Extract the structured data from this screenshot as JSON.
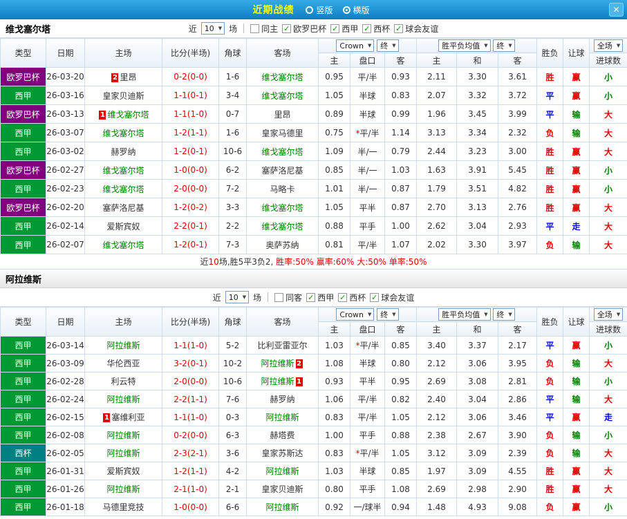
{
  "icons": {
    "check": "✓",
    "arrow_down": "▼",
    "close": "✕"
  },
  "colors": {
    "title_yellow": "#ffff00",
    "score_red": "#e60000",
    "win_red": "#e60000",
    "draw_blue": "#0000ff",
    "lose_green": "#008000",
    "team_green": "#008000",
    "opponent_dark": "#333333",
    "league_europa_purple": "#800080",
    "league_laliga_green": "#009933",
    "league_copa_teal": "#008080",
    "table_border": "#cdddeb"
  },
  "titlebar": {
    "title": "近期战绩",
    "view_options": [
      {
        "label": "竖版",
        "selected": false
      },
      {
        "label": "横版",
        "selected": true
      }
    ]
  },
  "filter_labels": {
    "near": "近",
    "matches": "场"
  },
  "table_header": {
    "type": "类型",
    "date": "日期",
    "home": "主场",
    "score": "比分(半场)",
    "corner": "角球",
    "away": "客场",
    "odds_company_select": "Crown",
    "odds_final_select": "终",
    "asia_sub": [
      "主",
      "盘口",
      "客"
    ],
    "europe_select": "胜平负均值",
    "europe_final_select": "终",
    "europe_sub": [
      "主",
      "和",
      "客"
    ],
    "result": "胜负",
    "handicap_result": "让球",
    "period_select": "全场",
    "goals": "进球数"
  },
  "sections": [
    {
      "team": "维戈塞尔塔",
      "near_count": "10",
      "filters": [
        {
          "label": "同主",
          "checked": false
        },
        {
          "label": "欧罗巴杯",
          "checked": true
        },
        {
          "label": "西甲",
          "checked": true
        },
        {
          "label": "西杯",
          "checked": true
        },
        {
          "label": "球会友谊",
          "checked": true
        }
      ],
      "rows": [
        {
          "type": "欧罗巴杯",
          "type_color": "#800080",
          "date": "26-03-20",
          "home": {
            "name": "里昂",
            "color": "#333333",
            "badge": "2",
            "badge_side": "left"
          },
          "score": "0-2(0-0)",
          "corner": "1-6",
          "away": {
            "name": "维戈塞尔塔",
            "color": "#008000"
          },
          "asia": [
            "0.95",
            "平/半",
            "0.93"
          ],
          "europe": [
            "2.11",
            "3.30",
            "3.61"
          ],
          "result": {
            "text": "胜",
            "color": "#e60000"
          },
          "handicap": {
            "text": "赢",
            "color": "#e60000"
          },
          "goals": {
            "text": "小",
            "color": "#008000"
          }
        },
        {
          "type": "西甲",
          "type_color": "#009933",
          "date": "26-03-16",
          "home": {
            "name": "皇家贝迪斯",
            "color": "#333333"
          },
          "score": "1-1(0-1)",
          "corner": "3-4",
          "away": {
            "name": "维戈塞尔塔",
            "color": "#008000"
          },
          "asia": [
            "1.05",
            "半球",
            "0.83"
          ],
          "europe": [
            "2.07",
            "3.32",
            "3.72"
          ],
          "result": {
            "text": "平",
            "color": "#0000ff"
          },
          "handicap": {
            "text": "赢",
            "color": "#e60000"
          },
          "goals": {
            "text": "小",
            "color": "#008000"
          }
        },
        {
          "type": "欧罗巴杯",
          "type_color": "#800080",
          "date": "26-03-13",
          "home": {
            "name": "维戈塞尔塔",
            "color": "#008000",
            "badge": "1",
            "badge_side": "left"
          },
          "score": "1-1(1-0)",
          "corner": "0-7",
          "away": {
            "name": "里昂",
            "color": "#333333"
          },
          "asia": [
            "0.89",
            "半球",
            "0.99"
          ],
          "europe": [
            "1.96",
            "3.45",
            "3.99"
          ],
          "result": {
            "text": "平",
            "color": "#0000ff"
          },
          "handicap": {
            "text": "输",
            "color": "#008000"
          },
          "goals": {
            "text": "大",
            "color": "#e60000"
          }
        },
        {
          "type": "西甲",
          "type_color": "#009933",
          "date": "26-03-07",
          "home": {
            "name": "维戈塞尔塔",
            "color": "#008000"
          },
          "score": "1-2(1-1)",
          "corner": "1-6",
          "away": {
            "name": "皇家马德里",
            "color": "#333333"
          },
          "asia": [
            "0.75",
            "*平/半",
            "1.14"
          ],
          "europe": [
            "3.13",
            "3.34",
            "2.32"
          ],
          "result": {
            "text": "负",
            "color": "#e60000"
          },
          "handicap": {
            "text": "输",
            "color": "#008000"
          },
          "goals": {
            "text": "大",
            "color": "#e60000"
          }
        },
        {
          "type": "西甲",
          "type_color": "#009933",
          "date": "26-03-02",
          "home": {
            "name": "赫罗纳",
            "color": "#333333"
          },
          "score": "1-2(0-1)",
          "corner": "10-6",
          "away": {
            "name": "维戈塞尔塔",
            "color": "#008000"
          },
          "asia": [
            "1.09",
            "半/一",
            "0.79"
          ],
          "europe": [
            "2.44",
            "3.23",
            "3.00"
          ],
          "result": {
            "text": "胜",
            "color": "#e60000"
          },
          "handicap": {
            "text": "赢",
            "color": "#e60000"
          },
          "goals": {
            "text": "大",
            "color": "#e60000"
          }
        },
        {
          "type": "欧罗巴杯",
          "type_color": "#800080",
          "date": "26-02-27",
          "home": {
            "name": "维戈塞尔塔",
            "color": "#008000"
          },
          "score": "1-0(0-0)",
          "corner": "6-2",
          "away": {
            "name": "塞萨洛尼基",
            "color": "#333333"
          },
          "asia": [
            "0.85",
            "半/一",
            "1.03"
          ],
          "europe": [
            "1.63",
            "3.91",
            "5.45"
          ],
          "result": {
            "text": "胜",
            "color": "#e60000"
          },
          "handicap": {
            "text": "赢",
            "color": "#e60000"
          },
          "goals": {
            "text": "小",
            "color": "#008000"
          }
        },
        {
          "type": "西甲",
          "type_color": "#009933",
          "date": "26-02-23",
          "home": {
            "name": "维戈塞尔塔",
            "color": "#008000"
          },
          "score": "2-0(0-0)",
          "corner": "7-2",
          "away": {
            "name": "马略卡",
            "color": "#333333"
          },
          "asia": [
            "1.01",
            "半/一",
            "0.87"
          ],
          "europe": [
            "1.79",
            "3.51",
            "4.82"
          ],
          "result": {
            "text": "胜",
            "color": "#e60000"
          },
          "handicap": {
            "text": "赢",
            "color": "#e60000"
          },
          "goals": {
            "text": "小",
            "color": "#008000"
          }
        },
        {
          "type": "欧罗巴杯",
          "type_color": "#800080",
          "date": "26-02-20",
          "home": {
            "name": "塞萨洛尼基",
            "color": "#333333"
          },
          "score": "1-2(0-2)",
          "corner": "3-3",
          "away": {
            "name": "维戈塞尔塔",
            "color": "#008000"
          },
          "asia": [
            "1.05",
            "平半",
            "0.87"
          ],
          "europe": [
            "2.70",
            "3.13",
            "2.76"
          ],
          "result": {
            "text": "胜",
            "color": "#e60000"
          },
          "handicap": {
            "text": "赢",
            "color": "#e60000"
          },
          "goals": {
            "text": "大",
            "color": "#e60000"
          }
        },
        {
          "type": "西甲",
          "type_color": "#009933",
          "date": "26-02-14",
          "home": {
            "name": "爱斯宾奴",
            "color": "#333333"
          },
          "score": "2-2(0-1)",
          "corner": "2-2",
          "away": {
            "name": "维戈塞尔塔",
            "color": "#008000"
          },
          "asia": [
            "0.88",
            "平手",
            "1.00"
          ],
          "europe": [
            "2.62",
            "3.04",
            "2.93"
          ],
          "result": {
            "text": "平",
            "color": "#0000ff"
          },
          "handicap": {
            "text": "走",
            "color": "#0000ff"
          },
          "goals": {
            "text": "大",
            "color": "#e60000"
          }
        },
        {
          "type": "西甲",
          "type_color": "#009933",
          "date": "26-02-07",
          "home": {
            "name": "维戈塞尔塔",
            "color": "#008000"
          },
          "score": "1-2(0-1)",
          "corner": "7-3",
          "away": {
            "name": "奥萨苏纳",
            "color": "#333333"
          },
          "asia": [
            "0.81",
            "平/半",
            "1.07"
          ],
          "europe": [
            "2.02",
            "3.30",
            "3.97"
          ],
          "result": {
            "text": "负",
            "color": "#e60000"
          },
          "handicap": {
            "text": "输",
            "color": "#008000"
          },
          "goals": {
            "text": "大",
            "color": "#e60000"
          }
        }
      ],
      "summary": [
        {
          "text": "近",
          "color": "#333333"
        },
        {
          "text": "10",
          "color": "#e60000"
        },
        {
          "text": "场,胜5平3负2, ",
          "color": "#333333"
        },
        {
          "text": "胜率:50%",
          "color": "#e60000"
        },
        {
          "text": " 赢率:60%",
          "color": "#e60000"
        },
        {
          "text": " 大:50%",
          "color": "#e60000"
        },
        {
          "text": " 单率:50%",
          "color": "#e60000"
        }
      ]
    },
    {
      "team": "阿拉维斯",
      "near_count": "10",
      "filters": [
        {
          "label": "同客",
          "checked": false
        },
        {
          "label": "西甲",
          "checked": true
        },
        {
          "label": "西杯",
          "checked": true
        },
        {
          "label": "球会友谊",
          "checked": true
        }
      ],
      "rows": [
        {
          "type": "西甲",
          "type_color": "#009933",
          "date": "26-03-14",
          "home": {
            "name": "阿拉维斯",
            "color": "#008000"
          },
          "score": "1-1(1-0)",
          "corner": "5-2",
          "away": {
            "name": "比利亚雷亚尔",
            "color": "#333333"
          },
          "asia": [
            "1.03",
            "*平/半",
            "0.85"
          ],
          "europe": [
            "3.40",
            "3.37",
            "2.17"
          ],
          "result": {
            "text": "平",
            "color": "#0000ff"
          },
          "handicap": {
            "text": "赢",
            "color": "#e60000"
          },
          "goals": {
            "text": "小",
            "color": "#008000"
          }
        },
        {
          "type": "西甲",
          "type_color": "#009933",
          "date": "26-03-09",
          "home": {
            "name": "华伦西亚",
            "color": "#333333"
          },
          "score": "3-2(0-1)",
          "corner": "10-2",
          "away": {
            "name": "阿拉维斯",
            "color": "#008000",
            "badge": "2",
            "badge_side": "right"
          },
          "asia": [
            "1.08",
            "半球",
            "0.80"
          ],
          "europe": [
            "2.12",
            "3.06",
            "3.95"
          ],
          "result": {
            "text": "负",
            "color": "#e60000"
          },
          "handicap": {
            "text": "输",
            "color": "#008000"
          },
          "goals": {
            "text": "大",
            "color": "#e60000"
          }
        },
        {
          "type": "西甲",
          "type_color": "#009933",
          "date": "26-02-28",
          "home": {
            "name": "利云特",
            "color": "#333333"
          },
          "score": "2-0(0-0)",
          "corner": "10-6",
          "away": {
            "name": "阿拉维斯",
            "color": "#008000",
            "badge": "1",
            "badge_side": "right"
          },
          "asia": [
            "0.93",
            "平半",
            "0.95"
          ],
          "europe": [
            "2.69",
            "3.08",
            "2.81"
          ],
          "result": {
            "text": "负",
            "color": "#e60000"
          },
          "handicap": {
            "text": "输",
            "color": "#008000"
          },
          "goals": {
            "text": "小",
            "color": "#008000"
          }
        },
        {
          "type": "西甲",
          "type_color": "#009933",
          "date": "26-02-24",
          "home": {
            "name": "阿拉维斯",
            "color": "#008000"
          },
          "score": "2-2(1-1)",
          "corner": "7-6",
          "away": {
            "name": "赫罗纳",
            "color": "#333333"
          },
          "asia": [
            "1.06",
            "平/半",
            "0.82"
          ],
          "europe": [
            "2.40",
            "3.04",
            "2.86"
          ],
          "result": {
            "text": "平",
            "color": "#0000ff"
          },
          "handicap": {
            "text": "输",
            "color": "#008000"
          },
          "goals": {
            "text": "大",
            "color": "#e60000"
          }
        },
        {
          "type": "西甲",
          "type_color": "#009933",
          "date": "26-02-15",
          "home": {
            "name": "塞维利亚",
            "color": "#333333",
            "badge": "1",
            "badge_side": "left"
          },
          "score": "1-1(1-0)",
          "corner": "0-3",
          "away": {
            "name": "阿拉维斯",
            "color": "#008000"
          },
          "asia": [
            "0.83",
            "平/半",
            "1.05"
          ],
          "europe": [
            "2.12",
            "3.06",
            "3.46"
          ],
          "result": {
            "text": "平",
            "color": "#0000ff"
          },
          "handicap": {
            "text": "赢",
            "color": "#e60000"
          },
          "goals": {
            "text": "走",
            "color": "#0000ff"
          }
        },
        {
          "type": "西甲",
          "type_color": "#009933",
          "date": "26-02-08",
          "home": {
            "name": "阿拉维斯",
            "color": "#008000"
          },
          "score": "0-2(0-0)",
          "corner": "6-3",
          "away": {
            "name": "赫塔费",
            "color": "#333333"
          },
          "asia": [
            "1.00",
            "平手",
            "0.88"
          ],
          "europe": [
            "2.38",
            "2.67",
            "3.90"
          ],
          "result": {
            "text": "负",
            "color": "#e60000"
          },
          "handicap": {
            "text": "输",
            "color": "#008000"
          },
          "goals": {
            "text": "小",
            "color": "#008000"
          }
        },
        {
          "type": "西杯",
          "type_color": "#008080",
          "date": "26-02-05",
          "home": {
            "name": "阿拉维斯",
            "color": "#008000"
          },
          "score": "2-3(2-1)",
          "corner": "3-6",
          "away": {
            "name": "皇家苏斯达",
            "color": "#333333"
          },
          "asia": [
            "0.83",
            "*平/半",
            "1.05"
          ],
          "europe": [
            "3.12",
            "3.09",
            "2.39"
          ],
          "result": {
            "text": "负",
            "color": "#e60000"
          },
          "handicap": {
            "text": "输",
            "color": "#008000"
          },
          "goals": {
            "text": "大",
            "color": "#e60000"
          }
        },
        {
          "type": "西甲",
          "type_color": "#009933",
          "date": "26-01-31",
          "home": {
            "name": "爱斯宾奴",
            "color": "#333333"
          },
          "score": "1-2(1-1)",
          "corner": "4-2",
          "away": {
            "name": "阿拉维斯",
            "color": "#008000"
          },
          "asia": [
            "1.03",
            "半球",
            "0.85"
          ],
          "europe": [
            "1.97",
            "3.09",
            "4.55"
          ],
          "result": {
            "text": "胜",
            "color": "#e60000"
          },
          "handicap": {
            "text": "赢",
            "color": "#e60000"
          },
          "goals": {
            "text": "大",
            "color": "#e60000"
          }
        },
        {
          "type": "西甲",
          "type_color": "#009933",
          "date": "26-01-26",
          "home": {
            "name": "阿拉维斯",
            "color": "#008000"
          },
          "score": "2-1(1-0)",
          "corner": "2-1",
          "away": {
            "name": "皇家贝迪斯",
            "color": "#333333"
          },
          "asia": [
            "0.80",
            "平手",
            "1.08"
          ],
          "europe": [
            "2.69",
            "2.98",
            "2.90"
          ],
          "result": {
            "text": "胜",
            "color": "#e60000"
          },
          "handicap": {
            "text": "赢",
            "color": "#e60000"
          },
          "goals": {
            "text": "大",
            "color": "#e60000"
          }
        },
        {
          "type": "西甲",
          "type_color": "#009933",
          "date": "26-01-18",
          "home": {
            "name": "马德里竞技",
            "color": "#333333"
          },
          "score": "1-0(0-0)",
          "corner": "6-6",
          "away": {
            "name": "阿拉维斯",
            "color": "#008000"
          },
          "asia": [
            "0.92",
            "一/球半",
            "0.94"
          ],
          "europe": [
            "1.48",
            "4.93",
            "9.08"
          ],
          "result": {
            "text": "负",
            "color": "#e60000"
          },
          "handicap": {
            "text": "赢",
            "color": "#e60000"
          },
          "goals": {
            "text": "小",
            "color": "#008000"
          }
        }
      ]
    }
  ]
}
